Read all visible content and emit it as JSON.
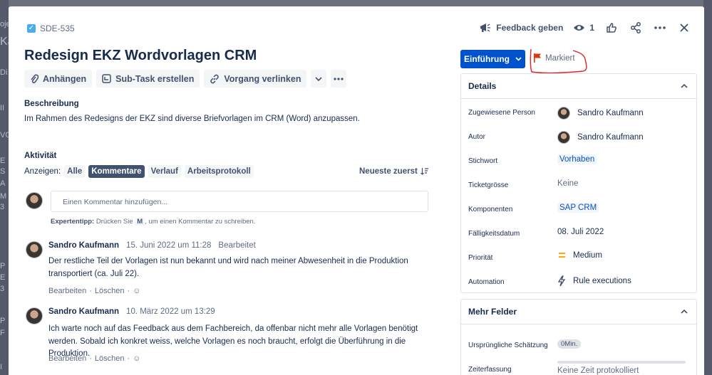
{
  "backdrop": {
    "fragments": [
      "oje",
      "Ka",
      "Di",
      "II",
      "VC",
      "E",
      "S",
      "A",
      "M",
      "3",
      "P",
      "E",
      "3",
      "P",
      "F",
      "I"
    ]
  },
  "issue": {
    "key": "SDE-535",
    "title": "Redesign EKZ Wordvorlagen CRM"
  },
  "header": {
    "feedback_label": "Feedback geben",
    "watch_count": "1"
  },
  "toolbar": {
    "attach": "Anhängen",
    "subtask": "Sub-Task erstellen",
    "link": "Vorgang verlinken"
  },
  "description": {
    "heading": "Beschreibung",
    "text": "Im Rahmen des Redesigns der EKZ sind diverse Briefvorlagen im CRM (Word) anzupassen."
  },
  "activity": {
    "heading": "Aktivität",
    "show_label": "Anzeigen:",
    "filters": [
      "Alle",
      "Kommentare",
      "Verlauf",
      "Arbeitsprotokoll"
    ],
    "active_filter": "Kommentare",
    "sort_label": "Neueste zuerst",
    "comment_placeholder": "Einen Kommentar hinzufügen...",
    "tip_bold": "Expertentipp:",
    "tip_pre": " Drücken Sie ",
    "tip_key": "M",
    "tip_post": ", um einen Kommentar zu schreiben.",
    "comments": [
      {
        "author": "Sandro Kaufmann",
        "date": "15. Juni 2022 um 11:28",
        "edited": "Bearbeitet",
        "body": "Der restliche Teil der Vorlagen ist nun bekannt und wird nach meiner Abwesenheit in die Produktion transportiert (ca. Juli 22).",
        "edit": "Bearbeiten",
        "delete": "Löschen"
      },
      {
        "author": "Sandro Kaufmann",
        "date": "10. März 2022 um 13:29",
        "edited": "",
        "body": "Ich warte noch auf das Feedback aus dem Fachbereich, da offenbar nicht mehr alle Vorlagen benötigt werden. Sobald ich konkret weiss, welche Vorlagen es noch braucht, erfolgt die Überführung in die Produktion.",
        "edit": "Bearbeiten",
        "delete": "Löschen"
      }
    ]
  },
  "status": {
    "label": "Einführung",
    "flag_label": "Markiert",
    "flag_color": "#de350b"
  },
  "details": {
    "heading": "Details",
    "fields": [
      {
        "label": "Zugewiesene Person",
        "value": "Sandro Kaufmann"
      },
      {
        "label": "Autor",
        "value": "Sandro Kaufmann"
      },
      {
        "label": "Stichwort",
        "value": "Vorhaben"
      },
      {
        "label": "Ticketgrösse",
        "value": "Keine"
      },
      {
        "label": "Komponenten",
        "value": "SAP CRM"
      },
      {
        "label": "Fälligkeitsdatum",
        "value": "08. Juli 2022"
      },
      {
        "label": "Priorität",
        "value": "Medium"
      },
      {
        "label": "Automation",
        "value": "Rule executions"
      }
    ]
  },
  "more_fields": {
    "heading": "Mehr Felder",
    "estimate_label": "Ursprüngliche Schätzung",
    "estimate_value": "0Min.",
    "time_label": "Zeiterfassung",
    "time_value": "Keine Zeit protokolliert"
  }
}
